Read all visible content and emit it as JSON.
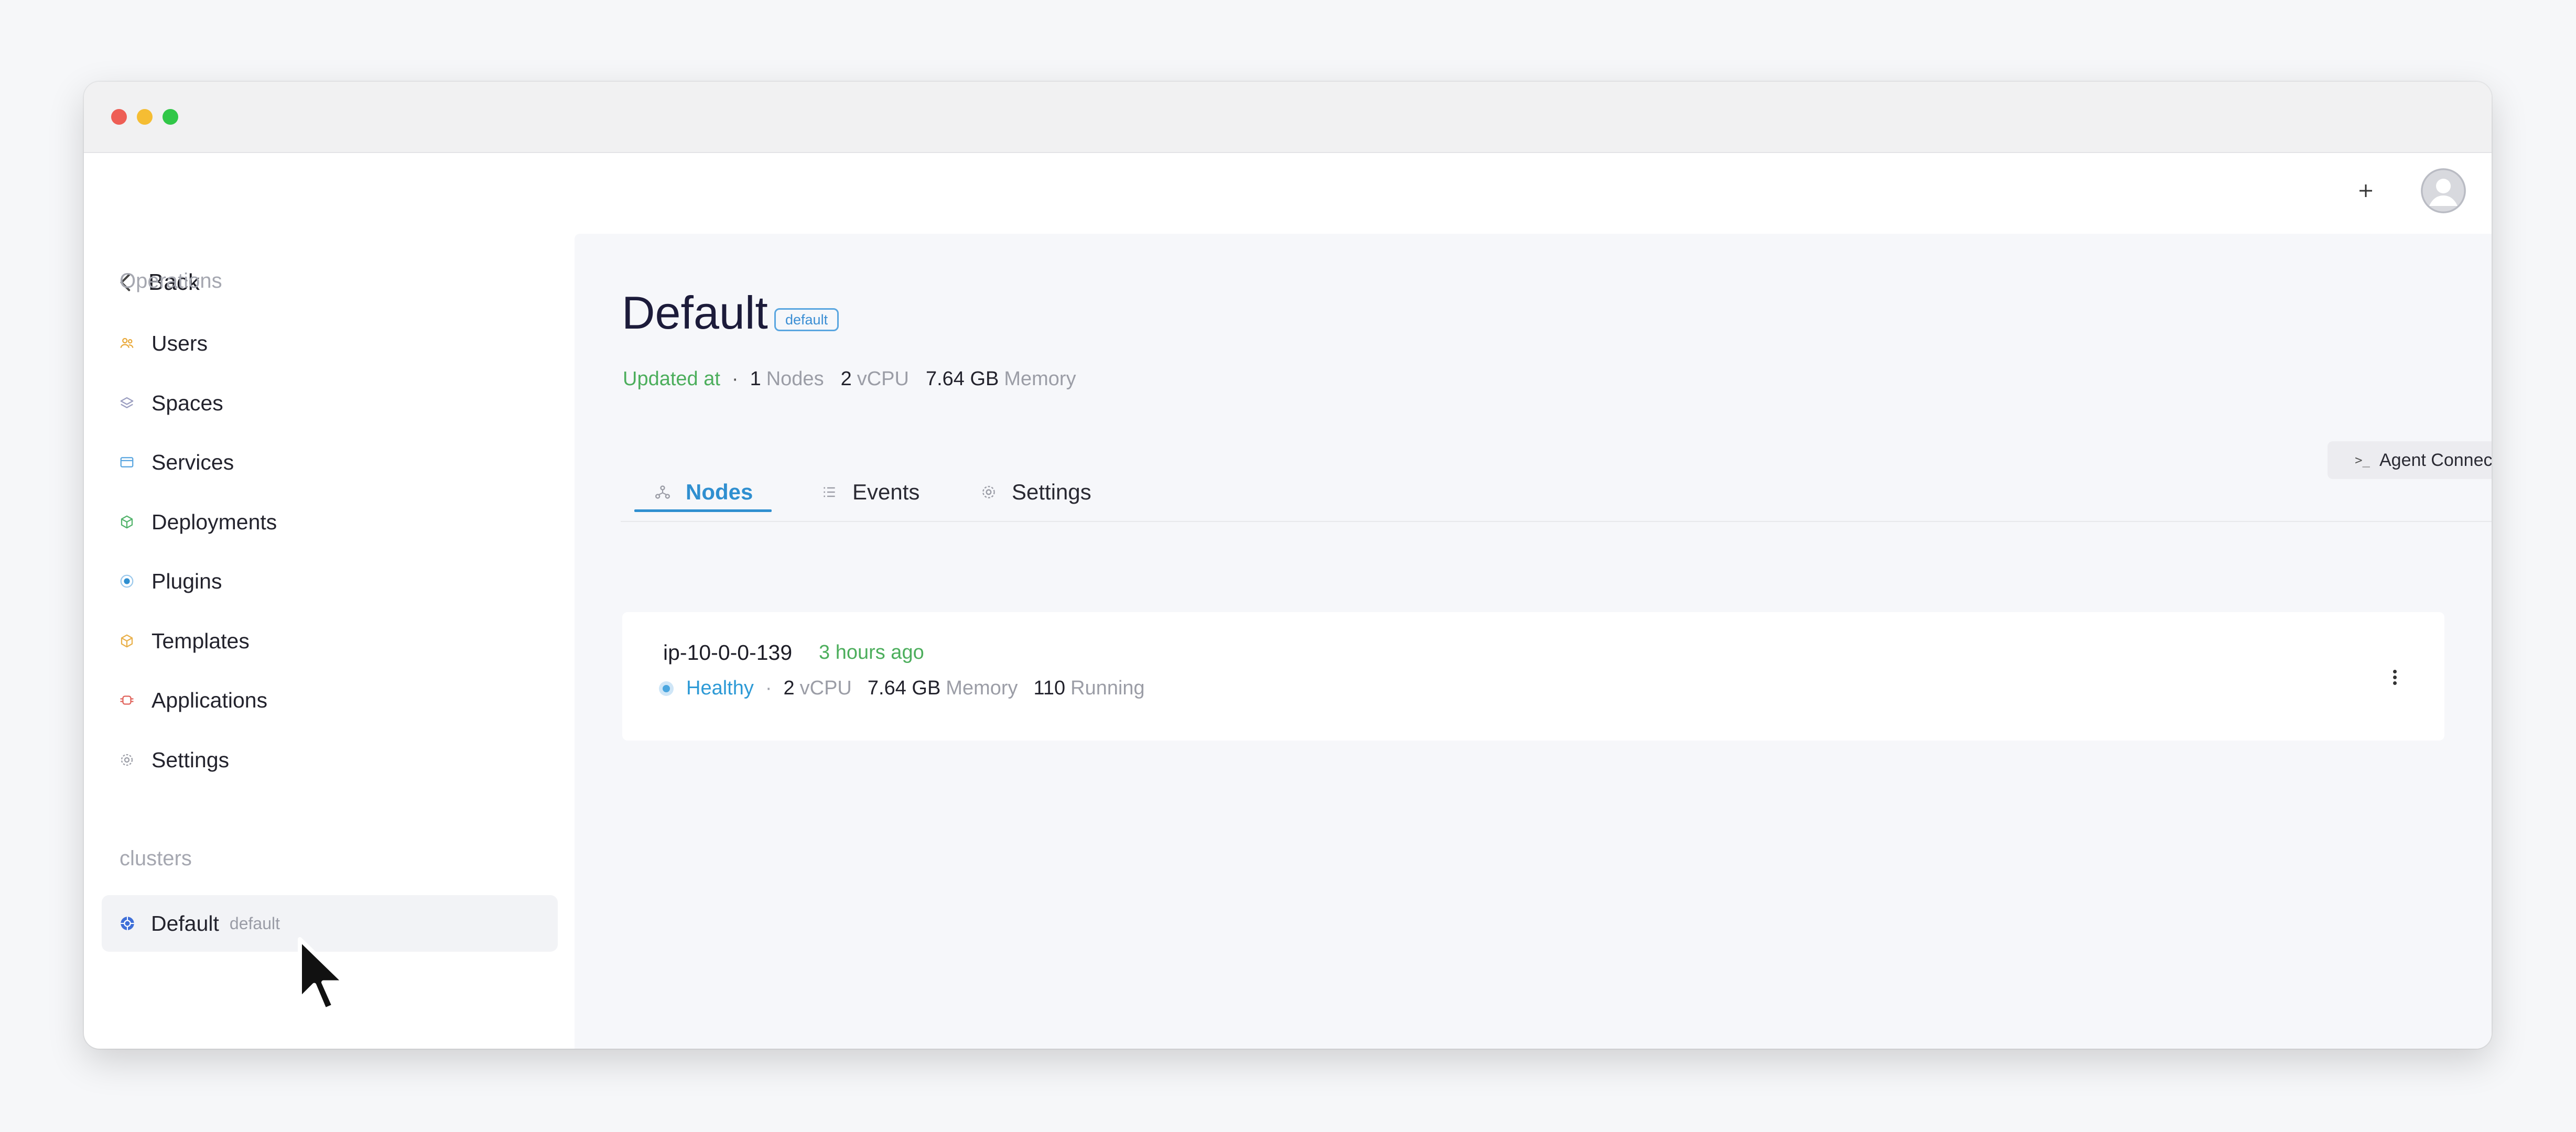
{
  "window": {
    "traffic_lights": [
      "close",
      "minimize",
      "maximize"
    ]
  },
  "sidebar": {
    "back_label": "Back",
    "operations_title": "Operations",
    "items": [
      {
        "label": "Users",
        "icon": "users-icon",
        "color": "#e9a93a"
      },
      {
        "label": "Spaces",
        "icon": "layers-icon",
        "color": "#9b9ec0"
      },
      {
        "label": "Services",
        "icon": "window-icon",
        "color": "#5aa6e0"
      },
      {
        "label": "Deployments",
        "icon": "box-icon",
        "color": "#52b36b"
      },
      {
        "label": "Plugins",
        "icon": "plugin-icon",
        "color": "#2f8fd0"
      },
      {
        "label": "Templates",
        "icon": "cube-icon",
        "color": "#e9b04a"
      },
      {
        "label": "Applications",
        "icon": "app-icon",
        "color": "#e0625a"
      },
      {
        "label": "Settings",
        "icon": "gear-icon",
        "color": "#9b9da6"
      }
    ],
    "clusters_title": "clusters",
    "cluster": {
      "label": "Default",
      "tag": "default",
      "icon": "cluster-icon",
      "color": "#3f6fd8"
    }
  },
  "header": {
    "add_icon": "plus-icon",
    "avatar_icon": "user-avatar-icon"
  },
  "main": {
    "title": "Default",
    "badge": "default",
    "meta": {
      "updated_label": "Updated at",
      "dot": "·",
      "nodes_value": "1",
      "nodes_label": "Nodes",
      "vcpu_value": "2",
      "vcpu_label": "vCPU",
      "memory_value": "7.64 GB",
      "memory_label": "Memory"
    },
    "agent_connect_label": "Agent Connect",
    "agent_connect_prefix": ">_",
    "tabs": [
      {
        "label": "Nodes",
        "icon": "nodes-icon",
        "active": true
      },
      {
        "label": "Events",
        "icon": "list-icon",
        "active": false
      },
      {
        "label": "Settings",
        "icon": "gear-icon",
        "active": false
      }
    ],
    "refresh_icon": "refresh-icon"
  },
  "node": {
    "name": "ip-10-0-0-139",
    "age": "3 hours ago",
    "status": "Healthy",
    "dot": "·",
    "vcpu_value": "2",
    "vcpu_label": "vCPU",
    "memory_value": "7.64 GB",
    "memory_label": "Memory",
    "running_value": "110",
    "running_label": "Running",
    "menu_icon": "more-vertical-icon"
  },
  "colors": {
    "accent": "#2f8fd0",
    "success": "#4cae5c",
    "text": "#1c1b3a",
    "muted": "#9b9da6"
  }
}
